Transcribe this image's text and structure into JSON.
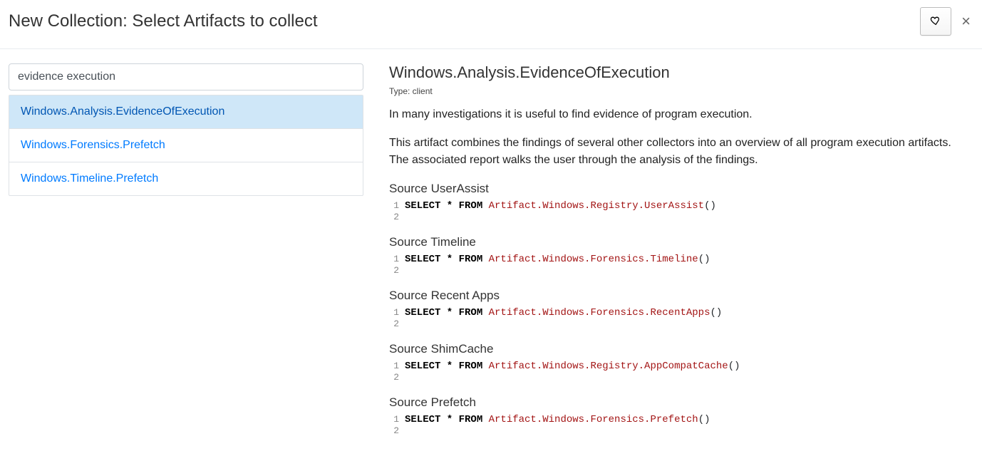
{
  "header": {
    "title": "New Collection: Select Artifacts to collect"
  },
  "search": {
    "value": "evidence execution"
  },
  "artifacts": [
    {
      "name": "Windows.Analysis.EvidenceOfExecution",
      "active": true
    },
    {
      "name": "Windows.Forensics.Prefetch",
      "active": false
    },
    {
      "name": "Windows.Timeline.Prefetch",
      "active": false
    }
  ],
  "detail": {
    "title": "Windows.Analysis.EvidenceOfExecution",
    "type": "Type: client",
    "desc1": "In many investigations it is useful to find evidence of program execution.",
    "desc2": "This artifact combines the findings of several other collectors into an overview of all program execution artifacts. The associated report walks the user through the analysis of the findings.",
    "sources": [
      {
        "title": "Source UserAssist",
        "prefix": "SELECT * FROM ",
        "call": "Artifact.Windows.Registry.UserAssist",
        "suffix": "()"
      },
      {
        "title": "Source Timeline",
        "prefix": "SELECT * FROM ",
        "call": "Artifact.Windows.Forensics.Timeline",
        "suffix": "()"
      },
      {
        "title": "Source Recent Apps",
        "prefix": "SELECT * FROM ",
        "call": "Artifact.Windows.Forensics.RecentApps",
        "suffix": "()"
      },
      {
        "title": "Source ShimCache",
        "prefix": "SELECT * FROM ",
        "call": "Artifact.Windows.Registry.AppCompatCache",
        "suffix": "()"
      },
      {
        "title": "Source Prefetch",
        "prefix": "SELECT * FROM ",
        "call": "Artifact.Windows.Forensics.Prefetch",
        "suffix": "()"
      }
    ]
  },
  "linenos": {
    "l1": "1",
    "l2": "2"
  }
}
